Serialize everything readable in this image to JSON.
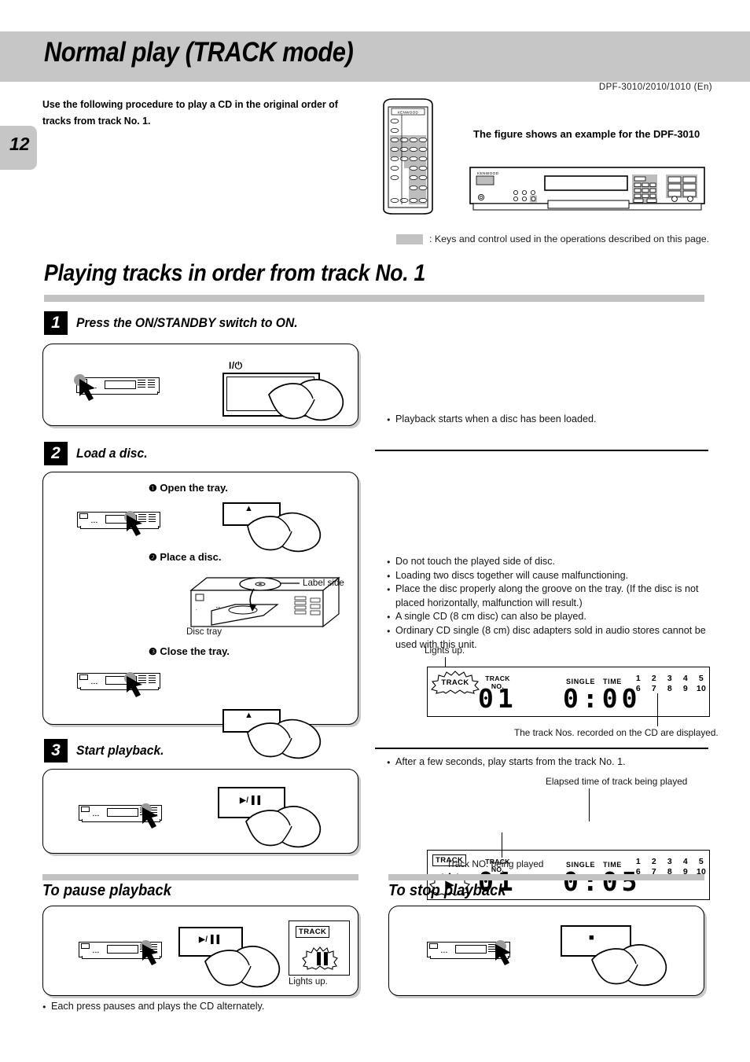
{
  "header": {
    "title": "Normal play  (TRACK mode)",
    "model_code": "DPF-3010/2010/1010 (En)",
    "page_number": "12"
  },
  "intro": {
    "text": "Use the following procedure to play a CD in the original order of tracks from track No. 1.",
    "figure_note": "The figure shows an example for the DPF-3010",
    "remote_brand": "KENWOOD",
    "unit_brand": "KENWOOD"
  },
  "legend": {
    "text": ": Keys and control used in the operations described on this page."
  },
  "section": {
    "heading": "Playing tracks in order from track No. 1"
  },
  "steps": [
    {
      "number": "1",
      "title": "Press the ON/STANDBY switch to ON.",
      "key_glyph": "I/⏻",
      "notes": [
        "Playback starts when a disc has been loaded."
      ]
    },
    {
      "number": "2",
      "title": "Load a disc.",
      "substeps": [
        {
          "marker": "❶",
          "label": "Open the tray.",
          "key_glyph": "▲"
        },
        {
          "marker": "❷",
          "label": "Place a disc."
        },
        {
          "marker": "❸",
          "label": "Close the tray.",
          "key_glyph": "▲"
        }
      ],
      "diagram_labels": {
        "label_side": "Label side",
        "disc_tray": "Disc tray"
      },
      "notes": [
        "Do not touch the played side of disc.",
        "Loading two discs together will cause malfunctioning.",
        "Place the disc properly along the groove on the tray. (If the disc is not placed horizontally, malfunction will result.)",
        "A single CD (8 cm disc) can also be played.",
        "Ordinary CD single (8 cm) disc adapters sold in audio stores cannot be used with this unit."
      ]
    },
    {
      "number": "3",
      "title": "Start playback.",
      "key_glyph": "▶/▐▐",
      "notes": [
        "After a few seconds, play starts from the track No. 1."
      ]
    }
  ],
  "display_loaded": {
    "indicator": "TRACK",
    "indicator_caption": "Lights up.",
    "track_no_label": "TRACK\nNO.",
    "track_digits": "01",
    "single_label": "SINGLE",
    "time_label": "TIME",
    "time_digits": "0:00",
    "grid_row1": [
      "1",
      "2",
      "3",
      "4",
      "5"
    ],
    "grid_row2": [
      "6",
      "7",
      "8",
      "9",
      "10"
    ],
    "caption": "The track Nos. recorded on the CD are displayed."
  },
  "display_playing": {
    "indicator": "TRACK",
    "play_symbol": "▶",
    "track_no_label": "TRACK\nNO.",
    "track_digits": "01",
    "single_label": "SINGLE",
    "time_label": "TIME",
    "time_digits": "0:05",
    "grid_row1": [
      "1",
      "2",
      "3",
      "4",
      "5"
    ],
    "grid_row2": [
      "6",
      "7",
      "8",
      "9",
      "10"
    ],
    "caption_top": "Elapsed time of track being played",
    "caption_bottom": "Track NO. being played"
  },
  "pause_section": {
    "title": "To pause playback",
    "key_glyph": "▶/▐▐",
    "indicator": "TRACK",
    "pause_symbol": "▐▐",
    "indicator_caption": "Lights up.",
    "note": "Each press pauses and plays the CD alternately."
  },
  "stop_section": {
    "title": "To stop playback",
    "key_glyph": "■"
  }
}
